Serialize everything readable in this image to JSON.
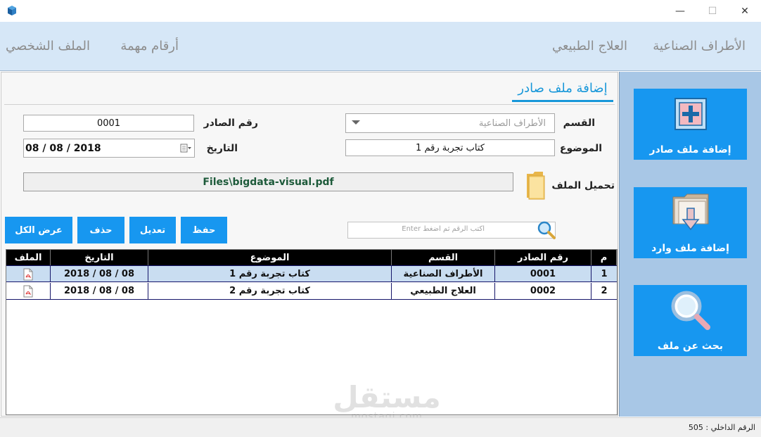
{
  "titlebar": {
    "minimize": "—",
    "maximize": "☐",
    "close": "✕"
  },
  "nav": {
    "item_prosthetics": "الأطراف الصناعية",
    "item_physio": "العلاج الطبيعي",
    "item_important_numbers": "أرقام مهمة",
    "item_profile": "الملف الشخصي"
  },
  "form": {
    "section_title": "إضافة ملف صادر",
    "department_label": "القسم",
    "department_value": "الأطراف الصناعية",
    "outgoing_no_label": "رقم الصادر",
    "outgoing_no_value": "0001",
    "subject_label": "الموضوع",
    "subject_value": "كتاب تجربة رقم 1",
    "date_label": "التاريخ",
    "date_value": "08 / 08 / 2018",
    "upload_label": "تحميل الملف",
    "file_path": "Files\\bigdata-visual.pdf"
  },
  "buttons": {
    "save": "حفظ",
    "edit": "تعديل",
    "delete": "حذف",
    "show_all": "عرض الكل"
  },
  "search": {
    "placeholder": "اكتب الرقم ثم اضغط Enter"
  },
  "table": {
    "headers": {
      "num": "م",
      "outgoing_no": "رقم الصادر",
      "department": "القسم",
      "subject": "الموضوع",
      "date": "التاريخ",
      "file": "الملف"
    },
    "rows": [
      {
        "num": "1",
        "outgoing_no": "0001",
        "department": "الأطراف الصناعية",
        "subject": "كتاب تجربة رقم 1",
        "date": "08 / 08 / 2018",
        "file_icon": "pdf-icon"
      },
      {
        "num": "2",
        "outgoing_no": "0002",
        "department": "العلاج الطبيعي",
        "subject": "كتاب تجربة رقم 2",
        "date": "08 / 08 / 2018",
        "file_icon": "pdf-icon"
      }
    ]
  },
  "sidebar": {
    "add_outgoing": "إضافة ملف صادر",
    "add_incoming": "إضافة ملف وارد",
    "search_file": "بحث عن ملف"
  },
  "status": {
    "internal_number": "الرقم الداخلي : 505"
  },
  "watermark": {
    "main": "مستقل",
    "sub": "mostaqi.com"
  },
  "colors": {
    "accent": "#1797f0",
    "nav_bg": "#d6e7f7",
    "sidebar_bg": "#a8c7e6",
    "selected_row": "#c9ddf1",
    "title_underline": "#1797d9"
  }
}
